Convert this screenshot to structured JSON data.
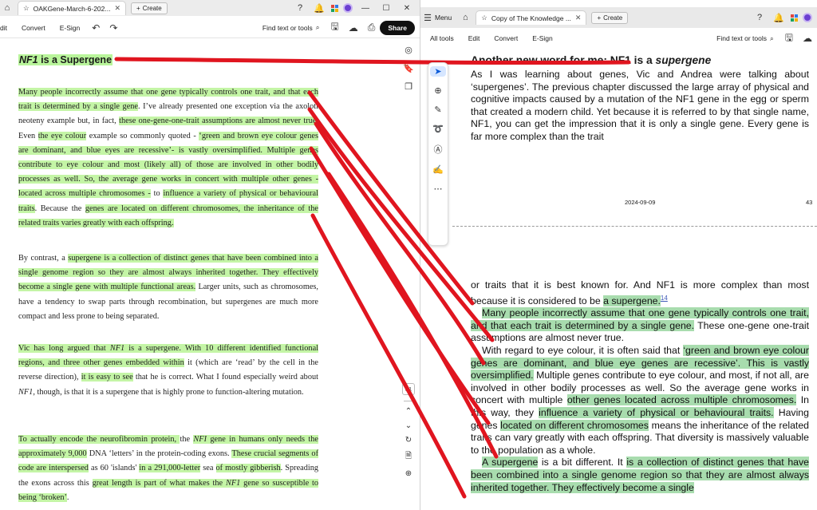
{
  "left": {
    "tab_title": "OAKGene-March-6-202...",
    "create_label": "Create",
    "toolbar": {
      "edit": "dit",
      "convert": "Convert",
      "esign": "E-Sign",
      "find": "Find text or tools",
      "share": "Share"
    },
    "heading_italic": "NF1",
    "heading_rest": " is a Supergene",
    "p1": {
      "a": "Many people incorrectly assume that one gene typically controls one trait, and that each trait is determined by a single gene",
      "b": ". I’ve already presented one exception via the axolotl neoteny example but, in fact, ",
      "c": "these one-gene-one-trait assumptions are almost never true",
      "d": ". Even ",
      "e": "the eye colour",
      "f": " example so commonly quoted - ",
      "g": "‘green and brown eye colour genes are dominant, and blue eyes are recessive’- is vastly oversimplified. Multiple genes contribute to eye colour and most (likely all) of those are involved in other bodily processes as well. So, the average gene works in concert with multiple other genes - located across multiple chromosomes -",
      "h": " to ",
      "i": "influence a variety of physical or behavioural traits",
      "j": ". Because the ",
      "k": "genes are located on different chromosomes, the inheritance of the related traits varies greatly with each offspring."
    },
    "p2": {
      "a": "By contrast, a ",
      "b": "supergene is a collection of distinct genes that have been combined into a single genome region so they are almost always inherited together. They effectively become a single gene with multiple functional areas.",
      "c": " Larger units, such as chromosomes, have a tendency to swap parts through recombination, but supergenes are much more compact and less prone to being separated."
    },
    "p3": {
      "a": "Vic has long argued that ",
      "b": "NF1",
      "c": " is a supergene. With 10 different identified functional regions, and three other genes embedded within",
      "d": " it (which are ‘read’ by the cell in the reverse direction), ",
      "e": "it is easy to see",
      "f": " that he is correct. What I found especially weird about ",
      "g": "NF1",
      "h": ", though, is that it is a supergene that is highly prone to function-altering mutation."
    },
    "p4": {
      "a": "To actually encode the neurofibromin protein, ",
      "b": "the ",
      "c": "NFI",
      "d": " gene in humans only needs the approximately 9,000",
      "e": " DNA ‘letters’ in the protein-coding exons. ",
      "f": "These crucial segments of code are interspersed",
      "g": " as 60 'islands' ",
      "h": "in a 291,000-letter",
      "i": " sea ",
      "j": "of mostly gibberish",
      "k": ". Spreading the exons across this ",
      "l": "great length is part of what makes the ",
      "m": "NF1",
      "n": " gene so susceptible to being ‘broken’",
      "o": "."
    },
    "rail_page": "81"
  },
  "right": {
    "menu_label": "Menu",
    "tab_title": "Copy of The Knowledge ...",
    "create_label": "Create",
    "toolbar": {
      "all_tools": "All tools",
      "edit": "Edit",
      "convert": "Convert",
      "esign": "E-Sign",
      "find": "Find text or tools"
    },
    "heading_a": "Another new word for me: NF1 is a ",
    "heading_b": "supergene",
    "p1": "As I was learning about genes, Vic and Andrea were talking about ‘supergenes’. The previous chapter discussed the large array of physical and cognitive impacts caused by a mutation of the NF1 gene in the egg or sperm that created a modern child. Yet because it is referred to by that single name, NF1, you can get the impression that it is only a single gene. Every gene is far more complex than the trait",
    "footer_date": "2024-09-09",
    "footer_page": "43",
    "p2": {
      "a": "or traits that it is best known for. And NF1 is more complex than most because it is considered to be ",
      "b": "a supergene.",
      "ref": "14",
      "c": "Many people incorrectly assume that one gene typically controls one trait, and that each trait is determined by a single gene.",
      "d": " These one-gene one-trait assumptions are almost never true.",
      "e": "With regard to eye colour, it is often said that ",
      "f": "‘green and brown eye colour genes are dominant, and blue eye genes are recessive’. This is vastly oversimplified.",
      "g": " Multiple genes contribute to eye colour, and most, if not all, are involved in other bodily processes as well. So the average gene works in concert with multiple ",
      "h": "other genes located across multiple chromosomes.",
      "i": " In this way, they ",
      "j": "influence a variety of physical or behavioural traits.",
      "k": " Having genes ",
      "l": "located on different chromosomes",
      "m": " means the inheritance of the related traits can vary greatly with each offspring.",
      "n": " That diversity is massively valuable to the population as a whole.",
      "o": "A supergene",
      "p": " is a bit different. It ",
      "q": "is a collection of distinct genes that have been combined into a single genome region so that they are almost always inherited together. They effectively become a single"
    }
  },
  "colors": {
    "left_highlight": "#c4f5a6",
    "right_highlight": "#a8dcae",
    "ink": "#e0151f"
  }
}
